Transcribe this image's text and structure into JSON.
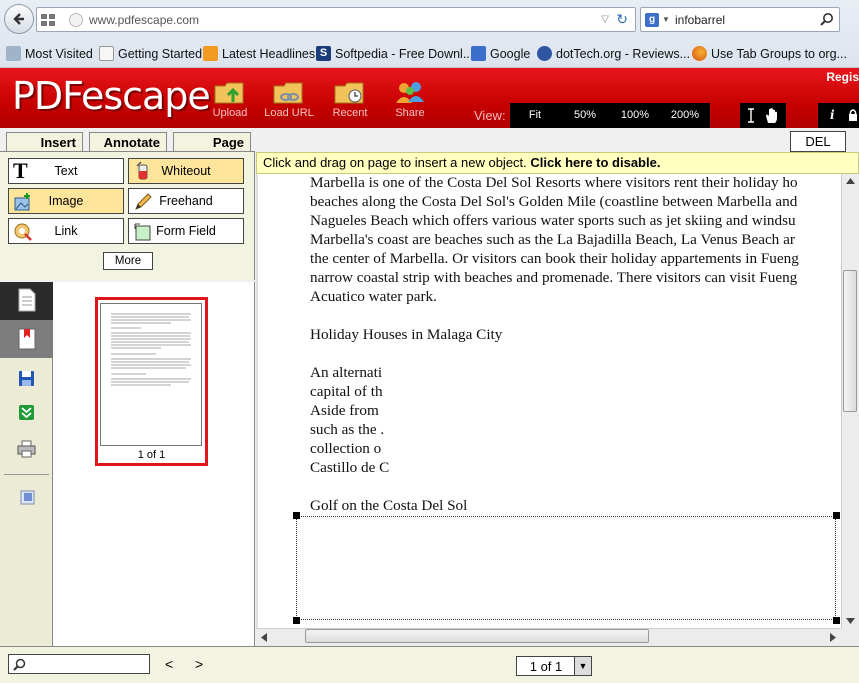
{
  "browser": {
    "url": "www.pdfescape.com",
    "search_query": "infobarrel",
    "search_engine_badge": "g",
    "bookmarks": [
      {
        "label": "Most Visited"
      },
      {
        "label": "Getting Started"
      },
      {
        "label": "Latest Headlines"
      },
      {
        "label": "Softpedia - Free Downl..."
      },
      {
        "label": "Google"
      },
      {
        "label": "dotTech.org - Reviews..."
      },
      {
        "label": "Use Tab Groups to org..."
      }
    ]
  },
  "app": {
    "logo": "PDFescape",
    "register": "Regis",
    "toolbar": [
      {
        "label": "Upload",
        "icon": "folder-upload-icon"
      },
      {
        "label": "Load URL",
        "icon": "folder-link-icon"
      },
      {
        "label": "Recent",
        "icon": "folder-clock-icon"
      },
      {
        "label": "Share",
        "icon": "people-icon"
      }
    ],
    "view_label": "View:",
    "zoom_options": [
      "Fit",
      "50%",
      "100%",
      "200%"
    ],
    "info_glyph": "i"
  },
  "left_panel": {
    "tabs": [
      "Insert",
      "Annotate",
      "Page"
    ],
    "insert_buttons": [
      {
        "label": "Text"
      },
      {
        "label": "Whiteout"
      },
      {
        "label": "Image"
      },
      {
        "label": "Freehand"
      },
      {
        "label": "Link"
      },
      {
        "label": "Form Field"
      }
    ],
    "more_label": "More",
    "thumbnail_label": "1 of 1"
  },
  "doc": {
    "del_label": "DEL",
    "hint_text": "Click and drag on page to insert a new object.",
    "hint_link": "Click here to disable.",
    "lines": [
      "Marbella is one of the Costa Del Sol Resorts where visitors rent their holiday ho",
      "beaches along the Costa Del Sol's Golden Mile (coastline between Marbella and",
      "Nagueles Beach which offers various water sports such as jet skiing and windsu",
      "Marbella's coast are beaches such as the La Bajadilla Beach, La Venus Beach ar",
      "the center of Marbella. Or visitors can book their holiday appartements in Fueng",
      "narrow coastal strip with beaches and promenade. There visitors can visit Fueng",
      "Acuatico water park.",
      "",
      "Holiday Houses in Malaga City",
      "",
      "An alternati",
      "capital of th",
      "Aside from",
      "such as the .",
      "collection o",
      "Castillo de C",
      "",
      "Golf on the Costa Del Sol"
    ]
  },
  "status": {
    "prev": "<",
    "next": ">",
    "page_value": "1 of 1"
  }
}
